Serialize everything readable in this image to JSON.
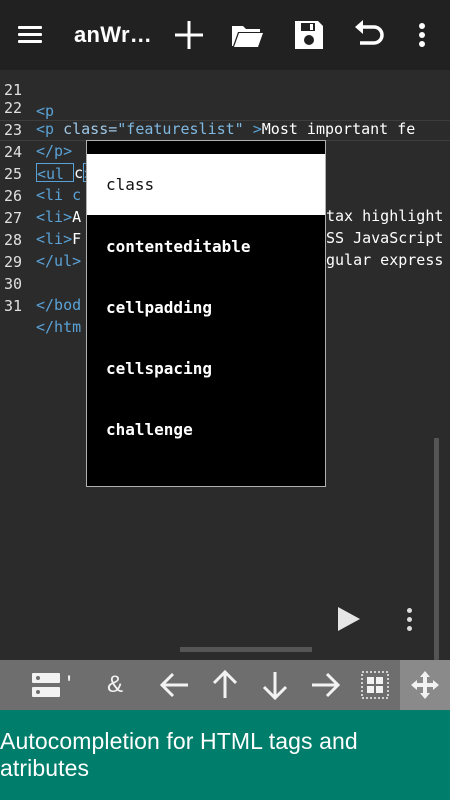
{
  "app": {
    "title": "anWr…"
  },
  "toolbar": {
    "menu_icon": "hamburger-menu-icon",
    "actions": [
      "add-icon",
      "folder-open-icon",
      "save-icon",
      "undo-icon",
      "overflow-menu-icon"
    ]
  },
  "editor": {
    "lines": [
      {
        "num": "21",
        "code": "<p"
      },
      {
        "num": "22",
        "tag_open": "<p ",
        "attr": "class=",
        "str": "\"featureslist\"",
        "tag_close": " >",
        "text": "Most important fe"
      },
      {
        "num": "23",
        "code": "</p>"
      },
      {
        "num": "24",
        "tag": "<ul",
        "typed": "c",
        "after": ">"
      },
      {
        "num": "25",
        "tag": "<li c",
        "text_right": "tax highlight"
      },
      {
        "num": "26",
        "tag": "<li>",
        "text_left": "A",
        "text_right": "SS JavaScript"
      },
      {
        "num": "27",
        "tag": "<li>",
        "text_left": "F",
        "text_right": "gular express"
      },
      {
        "num": "28",
        "code": "</ul>"
      },
      {
        "num": "29",
        "code": ""
      },
      {
        "num": "30",
        "code": "</bod"
      },
      {
        "num": "31",
        "code": "</htm"
      }
    ]
  },
  "autocomplete": {
    "items": [
      "class",
      "contenteditable",
      "cellpadding",
      "cellspacing",
      "challenge"
    ],
    "selected_index": 0
  },
  "symbol_bar": {
    "quote": "'",
    "ampersand": "&"
  },
  "caption": {
    "text": "Autocompletion for HTML tags and atributes"
  },
  "colors": {
    "toolbar": "#212121",
    "editor_bg": "#2b2b2b",
    "tag": "#5aa2d6",
    "caption_bg": "#007e6b",
    "symbar": "#6e6e6e"
  }
}
